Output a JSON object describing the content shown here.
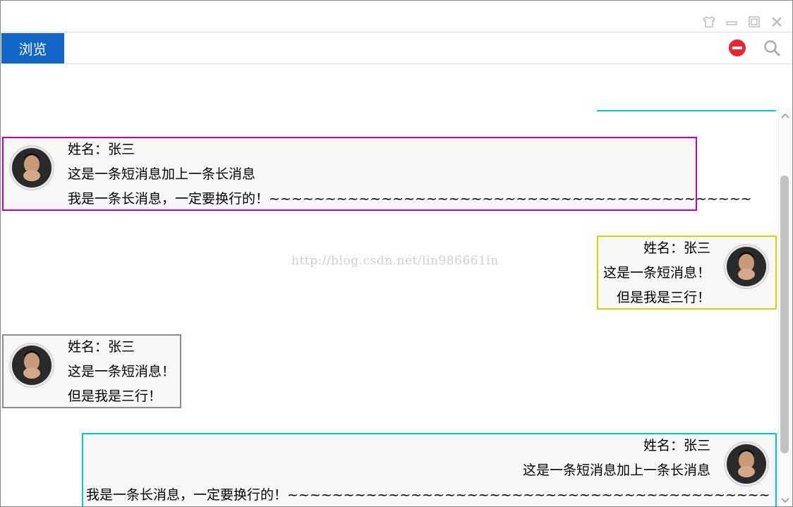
{
  "window": {
    "controls": [
      "skin-icon",
      "minimize-icon",
      "maximize-icon",
      "close-icon"
    ]
  },
  "toolbar": {
    "browse_tab_label": "浏览",
    "icons": [
      "stop-icon",
      "search-icon"
    ],
    "accent_color": "#1166c8"
  },
  "watermark": "http://blog.csdn.net/lin986661in",
  "messages": [
    {
      "side": "left",
      "border_color": "#c000c0",
      "lines": [
        "姓名：张三",
        " 这是一条短消息加上一条长消息",
        " 我是一条长消息，一定要换行的！~~~~~~~~~~~~~~~~~~~~~~~~~~~~~~~~~~~~~~~~~~~"
      ]
    },
    {
      "side": "right",
      "border_color": "#d8d000",
      "lines": [
        "姓名：张三",
        "这是一条短消息！",
        "但是我是三行！"
      ]
    },
    {
      "side": "left",
      "border_color": "#8c8c8c",
      "lines": [
        "姓名：张三",
        "这是一条短消息！",
        "但是我是三行！"
      ]
    },
    {
      "side": "right",
      "border_color": "#00c8d0",
      "lines": [
        "姓名：张三",
        "这是一条短消息加上一条长消息",
        "我是一条长消息，一定要换行的！~~~~~~~~~~~~~~~~~~~~~~~~~~~~~~~~~~~~~~~~~~~"
      ]
    }
  ]
}
